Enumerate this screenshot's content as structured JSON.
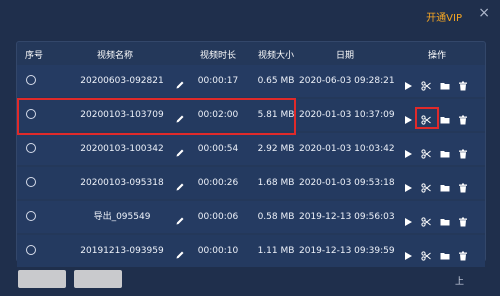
{
  "header": {
    "vip_label": "开通VIP",
    "close_glyph": "×"
  },
  "table": {
    "columns": [
      "序号",
      "视频名称",
      "视频时长",
      "视频大小",
      "日期",
      "操作"
    ],
    "rows": [
      {
        "name": "20200603-092821",
        "duration": "00:00:17",
        "size": "0.65 MB",
        "date": "2020-06-03 09:28:21"
      },
      {
        "name": "20200103-103709",
        "duration": "00:02:00",
        "size": "5.81 MB",
        "date": "2020-01-03 10:37:09"
      },
      {
        "name": "20200103-100342",
        "duration": "00:00:54",
        "size": "2.92 MB",
        "date": "2020-01-03 10:03:42"
      },
      {
        "name": "20200103-095318",
        "duration": "00:00:26",
        "size": "1.68 MB",
        "date": "2020-01-03 09:53:18"
      },
      {
        "name": "导出_095549",
        "duration": "00:00:06",
        "size": "0.58 MB",
        "date": "2019-12-13 09:56:03"
      },
      {
        "name": "20191213-093959",
        "duration": "00:00:10",
        "size": "1.11 MB",
        "date": "2019-12-13 09:39:59"
      }
    ]
  },
  "icons": {
    "play": "play-icon",
    "cut": "scissors-icon",
    "folder": "folder-icon",
    "trash": "trash-icon",
    "edit": "pencil-icon"
  },
  "colors": {
    "background": "#1f2f4c",
    "panel": "#24385a",
    "vip": "#f5a623",
    "highlight": "#e02a2a"
  },
  "footer": {
    "right_label": "上"
  }
}
